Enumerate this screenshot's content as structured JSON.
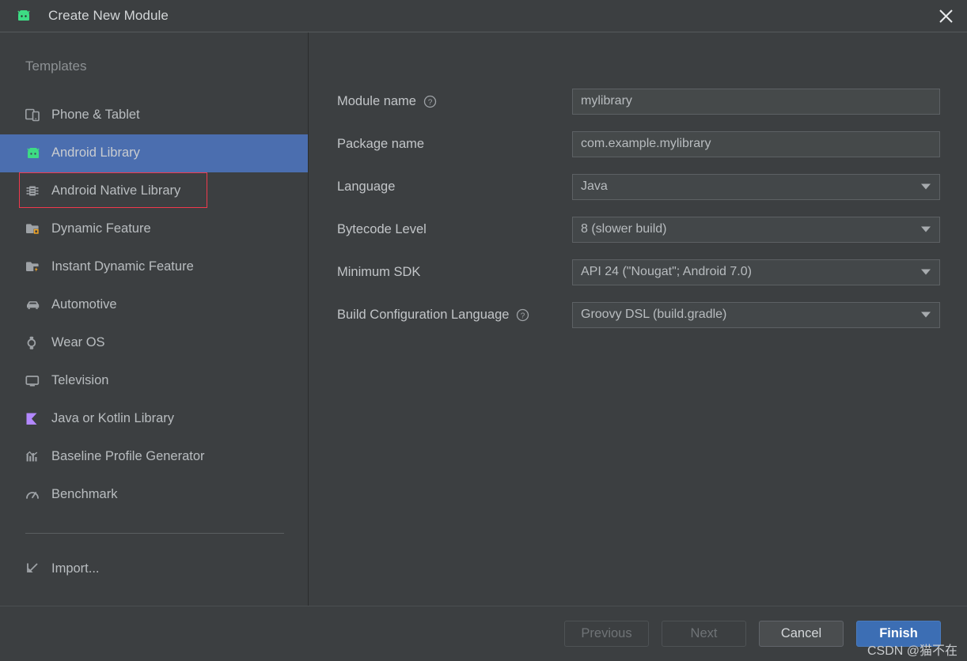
{
  "window": {
    "title": "Create New Module",
    "app_icon": "android-robot-icon",
    "close_label": "×"
  },
  "sidebar": {
    "header": "Templates",
    "items": [
      {
        "label": "Phone & Tablet",
        "icon": "phone-tablet-icon",
        "selected": false
      },
      {
        "label": "Android Library",
        "icon": "android-robot-icon",
        "selected": true
      },
      {
        "label": "Android Native Library",
        "icon": "chip-icon",
        "selected": false
      },
      {
        "label": "Dynamic Feature",
        "icon": "folder-module-icon",
        "selected": false
      },
      {
        "label": "Instant Dynamic Feature",
        "icon": "folder-lightning-icon",
        "selected": false
      },
      {
        "label": "Automotive",
        "icon": "car-icon",
        "selected": false
      },
      {
        "label": "Wear OS",
        "icon": "watch-icon",
        "selected": false
      },
      {
        "label": "Television",
        "icon": "television-icon",
        "selected": false
      },
      {
        "label": "Java or Kotlin Library",
        "icon": "kotlin-icon",
        "selected": false
      },
      {
        "label": "Baseline Profile Generator",
        "icon": "baseline-profile-icon",
        "selected": false
      },
      {
        "label": "Benchmark",
        "icon": "speedometer-icon",
        "selected": false
      }
    ],
    "import": {
      "label": "Import...",
      "icon": "import-arrow-icon"
    }
  },
  "form": {
    "fields": [
      {
        "label": "Module name",
        "help": true,
        "value": "mylibrary",
        "type": "text",
        "name": "module-name"
      },
      {
        "label": "Package name",
        "help": false,
        "value": "com.example.mylibrary",
        "type": "text",
        "name": "package-name"
      },
      {
        "label": "Language",
        "help": false,
        "value": "Java",
        "type": "select",
        "name": "language"
      },
      {
        "label": "Bytecode Level",
        "help": false,
        "value": "8 (slower build)",
        "type": "select",
        "name": "bytecode-level"
      },
      {
        "label": "Minimum SDK",
        "help": false,
        "value": "API 24 (\"Nougat\"; Android 7.0)",
        "type": "select",
        "name": "minimum-sdk"
      },
      {
        "label": "Build Configuration Language",
        "help": true,
        "value": "Groovy DSL (build.gradle)",
        "type": "select",
        "name": "build-config-language"
      }
    ]
  },
  "footer": {
    "previous": "Previous",
    "next": "Next",
    "cancel": "Cancel",
    "finish": "Finish"
  },
  "watermark": "CSDN @猫不在",
  "colors": {
    "background": "#3c3f41",
    "selection": "#4b6eaf",
    "annotation": "#f0394d",
    "primary_button": "#3c6eb4",
    "android_green": "#3ddc84",
    "kotlin_purple": "#b388ff",
    "accent_orange": "#f5a623"
  }
}
